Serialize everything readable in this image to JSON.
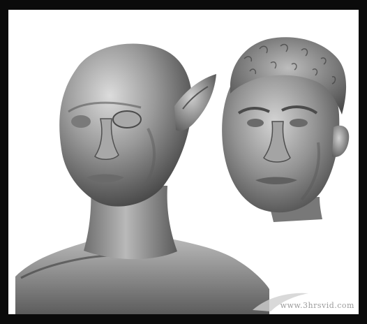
{
  "image": {
    "description_alt": "",
    "watermark_text": "www.3hrsvid.com"
  },
  "colors": {
    "border": "#0b0b0b",
    "background": "#ffffff",
    "sculpt_light": "#d9d9d9",
    "sculpt_mid": "#8f8f8f",
    "sculpt_dark": "#3e3e3e"
  }
}
